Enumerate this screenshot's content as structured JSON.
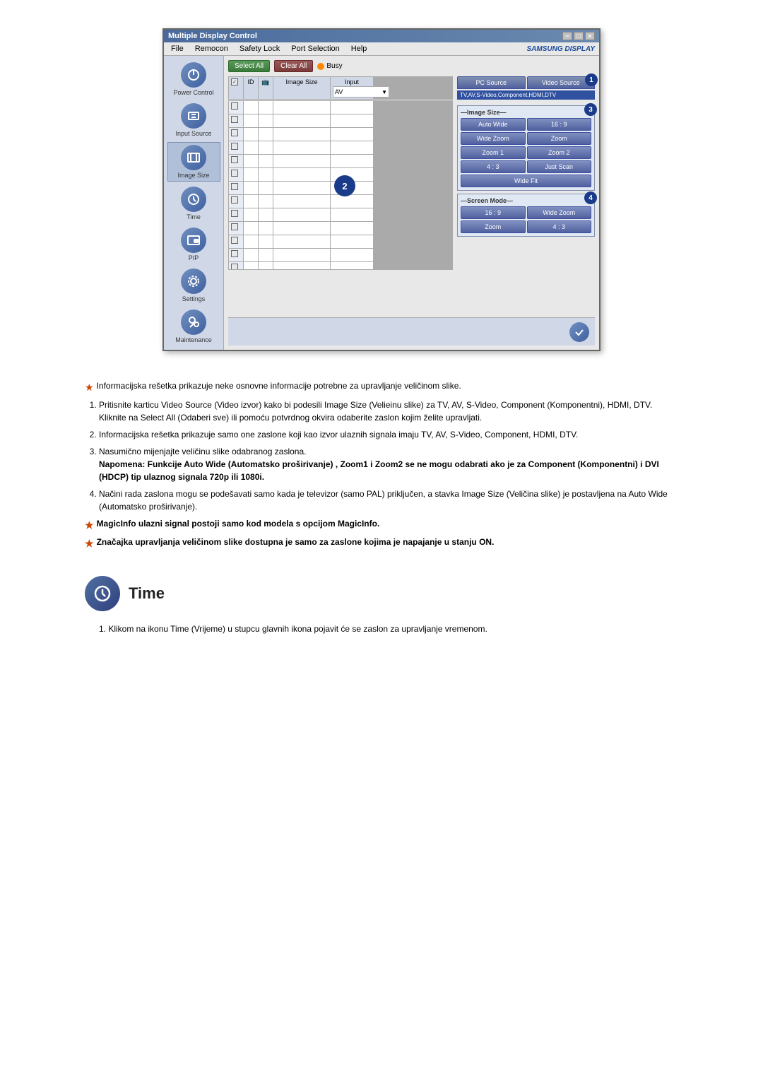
{
  "window": {
    "title": "Multiple Display Control",
    "title_bar_buttons": [
      "-",
      "□",
      "×"
    ],
    "menu_items": [
      "File",
      "Remocon",
      "Safety Lock",
      "Port Selection",
      "Help"
    ],
    "samsung_label": "SAMSUNG DISPLAY"
  },
  "toolbar": {
    "select_all": "Select All",
    "clear_all": "Clear All",
    "busy_label": "Busy"
  },
  "grid": {
    "headers": [
      "☑",
      "ID",
      "📺",
      "Image Size",
      "Input"
    ],
    "input_value": "AV",
    "rows": 14
  },
  "right_panel": {
    "badge1": "1",
    "badge2": "2",
    "badge3": "3",
    "badge4": "4",
    "tab_pc": "PC Source",
    "tab_video": "Video Source",
    "source_info": "TV,AV,S-Video,Component,HDMI,DTV",
    "image_size_label": "Image Size",
    "buttons": {
      "auto_wide": "Auto Wide",
      "ratio_16_9": "16 : 9",
      "wide_zoom": "Wide Zoom",
      "zoom": "Zoom",
      "zoom1": "Zoom 1",
      "zoom2": "Zoom 2",
      "ratio_4_3": "4 : 3",
      "just_scan": "Just Scan",
      "wide_fit": "Wide Fit"
    },
    "screen_mode_label": "Screen Mode",
    "screen_buttons": {
      "ratio_16_9": "16 : 9",
      "wide_zoom": "Wide Zoom",
      "zoom": "Zoom",
      "ratio_4_3": "4 : 3"
    }
  },
  "sidebar_items": [
    {
      "label": "Power Control",
      "id": "power"
    },
    {
      "label": "Input Source",
      "id": "input"
    },
    {
      "label": "Image Size",
      "id": "image",
      "active": true
    },
    {
      "label": "Time",
      "id": "time"
    },
    {
      "label": "PIP",
      "id": "pip"
    },
    {
      "label": "Settings",
      "id": "settings"
    },
    {
      "label": "Maintenance",
      "id": "maintenance"
    }
  ],
  "text_body": {
    "star1": "Informacijska rešetka prikazuje neke osnovne informacije potrebne za upravljanje veličinom slike.",
    "item1_title": "Pritisnite karticu Video Source (Video izvor) kako bi podesili Image Size (Velieinu slike) za TV, AV, S-Video, Component (Komponentni), HDMI, DTV.",
    "item1_sub": "Kliknite na Select All (Odaberi sve) ili pomoću potvrdnog okvira odaberite zaslon kojim želite upravljati.",
    "item2": "Informacijska rešetka prikazuje samo one zaslone koji kao izvor ulaznih signala imaju TV, AV, S-Video, Component, HDMI, DTV.",
    "item3_title": "Nasumično mijenjajte veličinu slike odabranog zaslona.",
    "item3_note": "Napomena: Funkcije Auto Wide (Automatsko proširivanje) , Zoom1 i Zoom2 se ne mogu odabrati ako je za Component (Komponentni) i DVI (HDCP) tip ulaznog signala 720p ili 1080i.",
    "item4": "Načini rada zaslona mogu se podešavati samo kada je televizor (samo PAL) priključen, a stavka Image Size (Veličina slike) je postavljena na Auto Wide (Automatsko proširivanje).",
    "star2": "MagicInfo ulazni signal postoji samo kod modela s opcijom MagicInfo.",
    "star3": "Značajka upravljanja veličinom slike dostupna je samo za zaslone kojima je napajanje u stanju ON."
  },
  "time_section": {
    "title": "Time",
    "description": "1.  Klikom na ikonu Time (Vrijeme) u stupcu glavnih ikona pojavit će se zaslon za upravljanje vremenom."
  }
}
